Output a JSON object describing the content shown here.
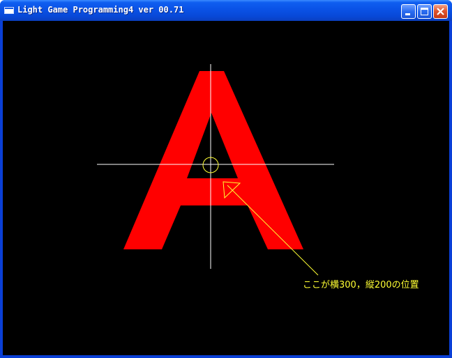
{
  "window": {
    "title": "Light Game Programming4 ver 00.71"
  },
  "titlebar_buttons": {
    "minimize": "minimize-icon",
    "maximize": "maximize-icon",
    "close": "close-icon"
  },
  "canvas": {
    "glyph_color": "#ff0000",
    "crosshair_color": "#ffffff",
    "annotation_color": "#ffff33",
    "annotation_text": "ここが横300，縦200の位置"
  }
}
